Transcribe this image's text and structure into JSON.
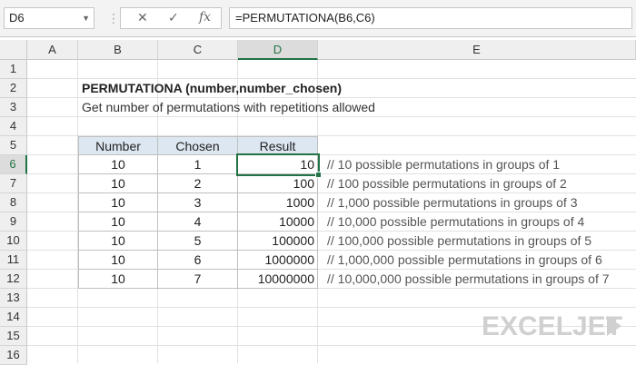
{
  "formula_bar": {
    "name_box": "D6",
    "cancel_icon": "✕",
    "enter_icon": "✓",
    "fx_label": "fx",
    "formula": "=PERMUTATIONA(B6,C6)"
  },
  "columns": [
    "A",
    "B",
    "C",
    "D",
    "E"
  ],
  "rows": [
    "1",
    "2",
    "3",
    "4",
    "5",
    "6",
    "7",
    "8",
    "9",
    "10",
    "11",
    "12",
    "13",
    "14",
    "15",
    "16"
  ],
  "sheet": {
    "title": "PERMUTATIONA (number,number_chosen)",
    "subtitle": "Get number of permutations with repetitions allowed",
    "table": {
      "headers": [
        "Number",
        "Chosen",
        "Result"
      ],
      "rows": [
        [
          "10",
          "1",
          "10"
        ],
        [
          "10",
          "2",
          "100"
        ],
        [
          "10",
          "3",
          "1000"
        ],
        [
          "10",
          "4",
          "10000"
        ],
        [
          "10",
          "5",
          "100000"
        ],
        [
          "10",
          "6",
          "1000000"
        ],
        [
          "10",
          "7",
          "10000000"
        ]
      ]
    },
    "comments": [
      "// 10 possible permutations in groups of 1",
      "// 100 possible permutations in groups of 2",
      "// 1,000 possible permutations in groups of 3",
      "// 10,000 possible permutations in groups of 4",
      "// 100,000 possible permutations in groups of 5",
      "// 1,000,000 possible permutations in groups of 6",
      "// 10,000,000 possible permutations in groups of 7"
    ]
  },
  "logo": "EXCELJET",
  "colors": {
    "accent": "#217346",
    "header_fill": "#dde7f1"
  }
}
